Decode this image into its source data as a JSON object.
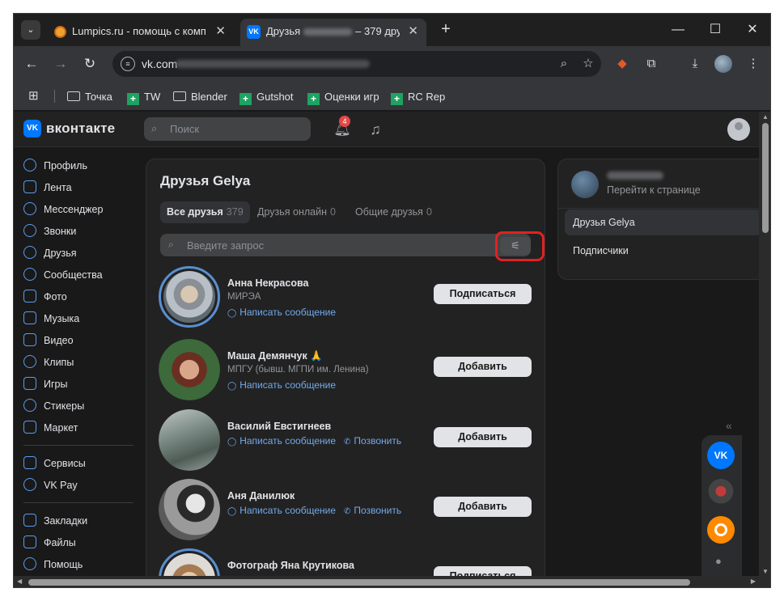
{
  "browser": {
    "tabs": [
      {
        "title": "Lumpics.ru - помощь с компь"
      },
      {
        "title_prefix": "Друзья",
        "title_suffix": "– 379 дру"
      }
    ],
    "address": "vk.com",
    "bookmarks": [
      "Точка",
      "TW",
      "Blender",
      "Gutshot",
      "Оценки игр",
      "RC Rep"
    ]
  },
  "vk": {
    "brand": "вконтакте",
    "search_placeholder": "Поиск",
    "notifications_count": "4",
    "sidebar": {
      "group1": [
        "Профиль",
        "Лента",
        "Мессенджер",
        "Звонки",
        "Друзья",
        "Сообщества",
        "Фото",
        "Музыка",
        "Видео",
        "Клипы",
        "Игры",
        "Стикеры",
        "Маркет"
      ],
      "group2": [
        "Сервисы",
        "VK Pay"
      ],
      "group3": [
        "Закладки",
        "Файлы",
        "Помощь"
      ]
    },
    "page_title": "Друзья Gelya",
    "tabs": [
      {
        "label": "Все друзья",
        "count": "379"
      },
      {
        "label": "Друзья онлайн",
        "count": "0"
      },
      {
        "label": "Общие друзья",
        "count": "0"
      }
    ],
    "friends_search_placeholder": "Введите запрос",
    "friends": [
      {
        "name": "Анна Некрасова",
        "subtitle": "МИРЭА",
        "message": "Написать сообщение",
        "call": "",
        "action": "Подписаться"
      },
      {
        "name": "Маша Демянчук 🙏",
        "subtitle": "МПГУ (бывш. МГПИ им. Ленина)",
        "message": "Написать сообщение",
        "call": "",
        "action": "Добавить"
      },
      {
        "name": "Василий Евстигнеев",
        "subtitle": "",
        "message": "Написать сообщение",
        "call": "Позвонить",
        "action": "Добавить"
      },
      {
        "name": "Аня Данилюк",
        "subtitle": "",
        "message": "Написать сообщение",
        "call": "Позвонить",
        "action": "Добавить"
      },
      {
        "name": "Фотограф Яна Крутикова",
        "subtitle": "",
        "message": "",
        "call": "",
        "action": "Подписаться"
      }
    ],
    "right_panel": {
      "go_to_page": "Перейти к странице",
      "items": [
        "Друзья Gelya",
        "Подписчики"
      ]
    }
  },
  "colors": {
    "accent": "#71aaeb",
    "vk_blue": "#0077ff",
    "highlight": "#e12221",
    "badge": "#e64646"
  }
}
